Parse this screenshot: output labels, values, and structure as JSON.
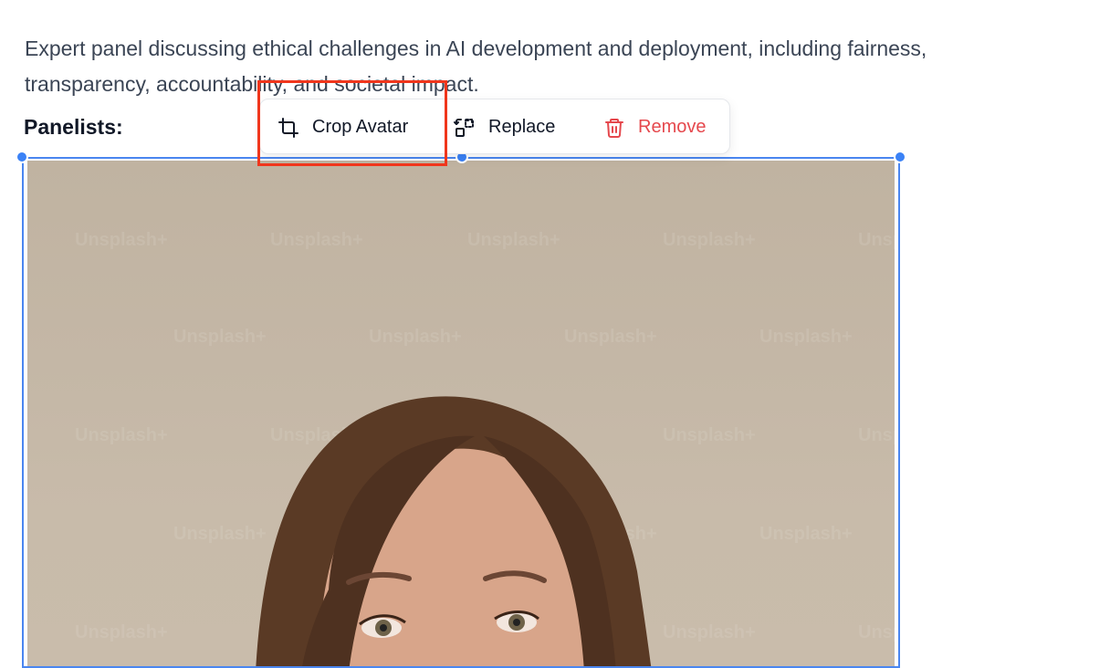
{
  "content": {
    "description": "Expert panel discussing ethical challenges in AI development and deployment, including fairness, transparency, accountability, and societal impact.",
    "panelists_label": "Panelists:"
  },
  "image": {
    "watermark": "Unsplash+"
  },
  "toolbar": {
    "crop_label": "Crop Avatar",
    "replace_label": "Replace",
    "remove_label": "Remove"
  },
  "colors": {
    "selection": "#4a86f0",
    "remove": "#e5484d",
    "highlight": "#f0361c"
  },
  "icons": {
    "crop": "crop-icon",
    "replace": "replace-image-icon",
    "remove": "trash-icon"
  }
}
